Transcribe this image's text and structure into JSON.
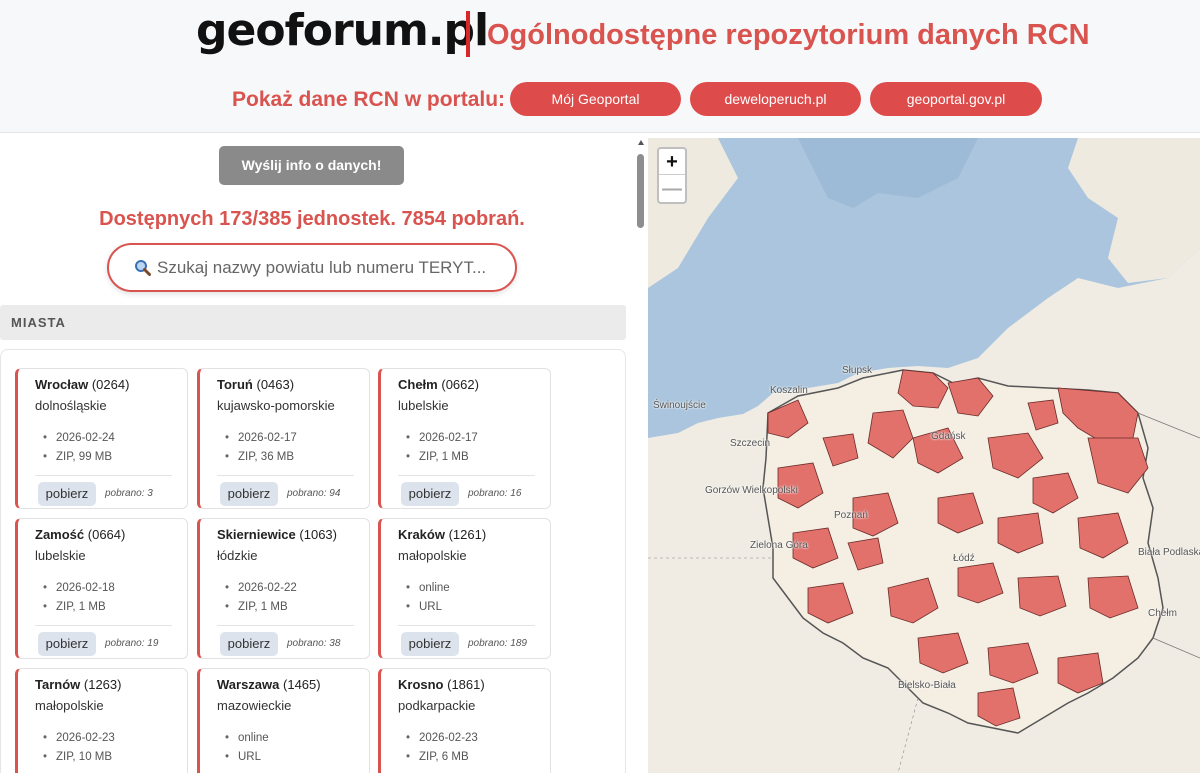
{
  "header": {
    "logo_text": "geoforum.pl",
    "title": "Ogólnodostępne repozytorium danych RCN",
    "portal_label": "Pokaż dane RCN w portalu:",
    "portal_buttons": [
      "Mój Geoportal",
      "deweloperuch.pl",
      "geoportal.gov.pl"
    ],
    "accent_color": "#d9534f"
  },
  "left_panel": {
    "send_button": "Wyślij info o danych!",
    "stats": "Dostępnych 173/385 jednostek. 7854 pobrań.",
    "search": {
      "placeholder": "Szukaj nazwy powiatu lub numeru TERYT...",
      "icon": "magnifier-icon"
    },
    "section_title": "MIASTA",
    "download_label": "pobierz",
    "cards": [
      {
        "city": "Wrocław",
        "code": "(0264)",
        "region": "dolnośląskie",
        "date": "2026-02-24",
        "format": "ZIP, 99 MB",
        "downloads": "pobrano: 3"
      },
      {
        "city": "Toruń",
        "code": "(0463)",
        "region": "kujawsko-pomorskie",
        "date": "2026-02-17",
        "format": "ZIP, 36 MB",
        "downloads": "pobrano: 94"
      },
      {
        "city": "Chełm",
        "code": "(0662)",
        "region": "lubelskie",
        "date": "2026-02-17",
        "format": "ZIP, 1 MB",
        "downloads": "pobrano: 16"
      },
      {
        "city": "Zamość",
        "code": "(0664)",
        "region": "lubelskie",
        "date": "2026-02-18",
        "format": "ZIP, 1 MB",
        "downloads": "pobrano: 19"
      },
      {
        "city": "Skierniewice",
        "code": "(1063)",
        "region": "łódzkie",
        "date": "2026-02-22",
        "format": "ZIP, 1 MB",
        "downloads": "pobrano: 38"
      },
      {
        "city": "Kraków",
        "code": "(1261)",
        "region": "małopolskie",
        "date": "online",
        "format": "URL",
        "downloads": "pobrano: 189"
      },
      {
        "city": "Tarnów",
        "code": "(1263)",
        "region": "małopolskie",
        "date": "2026-02-23",
        "format": "ZIP, 10 MB",
        "downloads": ""
      },
      {
        "city": "Warszawa",
        "code": "(1465)",
        "region": "mazowieckie",
        "date": "online",
        "format": "URL",
        "downloads": ""
      },
      {
        "city": "Krosno",
        "code": "(1861)",
        "region": "podkarpackie",
        "date": "2026-02-23",
        "format": "ZIP, 6 MB",
        "downloads": ""
      }
    ]
  },
  "map": {
    "zoom_in": "+",
    "zoom_out": "—",
    "sea_color": "#aac5dd",
    "land_color": "#eee9df",
    "highlight_color": "#e2706b",
    "labels": [
      "Słupsk",
      "Koszalin",
      "Świnoujście",
      "Szczecin",
      "Gorzów Wielkopolski",
      "Zielona Góra",
      "Poznań",
      "Gdańsk",
      "Łódź",
      "Biała Podlaska",
      "Chełm",
      "Bielsko-Biała"
    ]
  }
}
